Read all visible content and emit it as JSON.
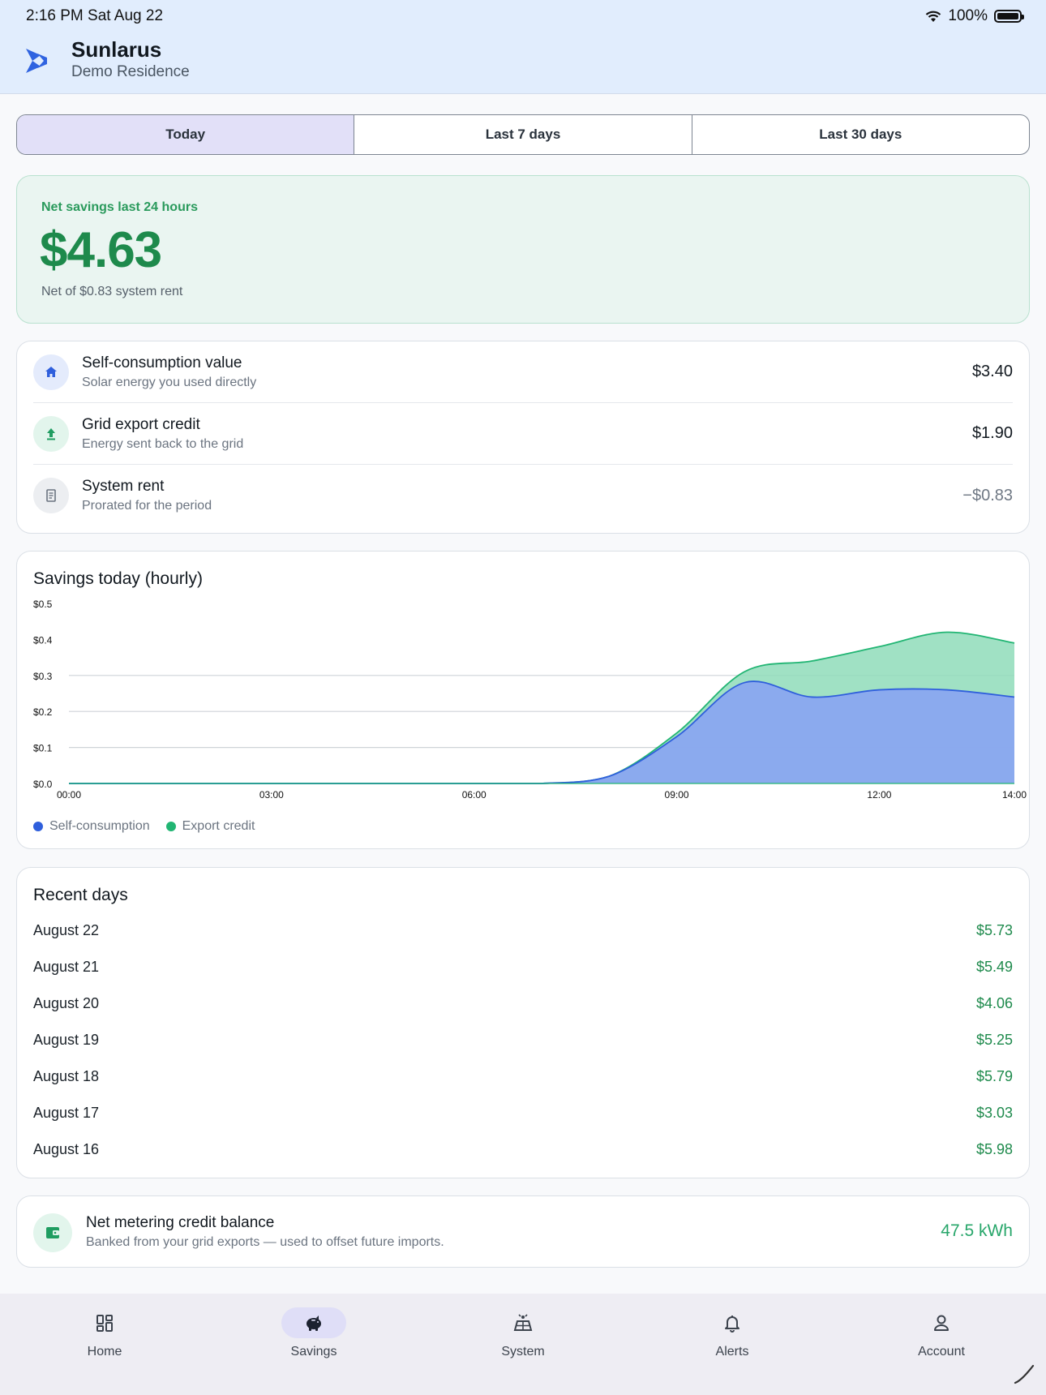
{
  "status": {
    "time": "2:16 PM   Sat Aug 22",
    "battery": "100%"
  },
  "header": {
    "title": "Sunlarus",
    "subtitle": "Demo Residence"
  },
  "segments": [
    {
      "label": "Today",
      "active": true
    },
    {
      "label": "Last 7 days",
      "active": false
    },
    {
      "label": "Last 30 days",
      "active": false
    }
  ],
  "hero": {
    "label": "Net savings last 24 hours",
    "value": "$4.63",
    "note": "Net of $0.83 system rent"
  },
  "breakdown": [
    {
      "title": "Self-consumption value",
      "subtitle": "Solar energy you used directly",
      "value": "$3.40",
      "icon": "home-icon"
    },
    {
      "title": "Grid export credit",
      "subtitle": "Energy sent back to the grid",
      "value": "$1.90",
      "icon": "upload-icon"
    },
    {
      "title": "System rent",
      "subtitle": "Prorated for the period",
      "value": "−$0.83",
      "icon": "receipt-icon"
    }
  ],
  "colors": {
    "self": "#2f5fdc",
    "export": "#21b573",
    "accent_green": "#1e8a4c"
  },
  "chart_data": {
    "type": "area",
    "title": "Savings today (hourly)",
    "x": [
      0,
      1,
      2,
      3,
      4,
      5,
      6,
      7,
      8,
      9,
      10,
      11,
      12,
      13,
      14
    ],
    "x_tick_labels": [
      "00:00",
      "03:00",
      "06:00",
      "09:00",
      "12:00",
      "14:00"
    ],
    "x_tick_values": [
      0,
      3,
      6,
      9,
      12,
      14
    ],
    "y_tick_labels": [
      "$0.0",
      "$0.1",
      "$0.2",
      "$0.3",
      "$0.4",
      "$0.5"
    ],
    "ylim": [
      0,
      0.5
    ],
    "series": [
      {
        "name": "Self-consumption",
        "values": [
          0,
          0,
          0,
          0,
          0,
          0,
          0,
          0,
          0.02,
          0.13,
          0.28,
          0.24,
          0.26,
          0.26,
          0.24
        ]
      },
      {
        "name": "Export credit",
        "values": [
          0,
          0,
          0,
          0,
          0,
          0,
          0,
          0,
          0.0,
          0.01,
          0.03,
          0.1,
          0.12,
          0.16,
          0.15
        ]
      }
    ],
    "legend": "bottom-left",
    "grid": true
  },
  "recent": {
    "title": "Recent days",
    "rows": [
      {
        "date": "August 22",
        "amount": "$5.73"
      },
      {
        "date": "August 21",
        "amount": "$5.49"
      },
      {
        "date": "August 20",
        "amount": "$4.06"
      },
      {
        "date": "August 19",
        "amount": "$5.25"
      },
      {
        "date": "August 18",
        "amount": "$5.79"
      },
      {
        "date": "August 17",
        "amount": "$3.03"
      },
      {
        "date": "August 16",
        "amount": "$5.98"
      }
    ]
  },
  "credit": {
    "title": "Net metering credit balance",
    "subtitle": "Banked from your grid exports — used to offset future imports.",
    "value": "47.5 kWh"
  },
  "nav": [
    {
      "label": "Home",
      "icon": "dashboard-icon",
      "active": false
    },
    {
      "label": "Savings",
      "icon": "piggy-bank-icon",
      "active": true
    },
    {
      "label": "System",
      "icon": "solar-panel-icon",
      "active": false
    },
    {
      "label": "Alerts",
      "icon": "bell-icon",
      "active": false
    },
    {
      "label": "Account",
      "icon": "person-icon",
      "active": false
    }
  ]
}
